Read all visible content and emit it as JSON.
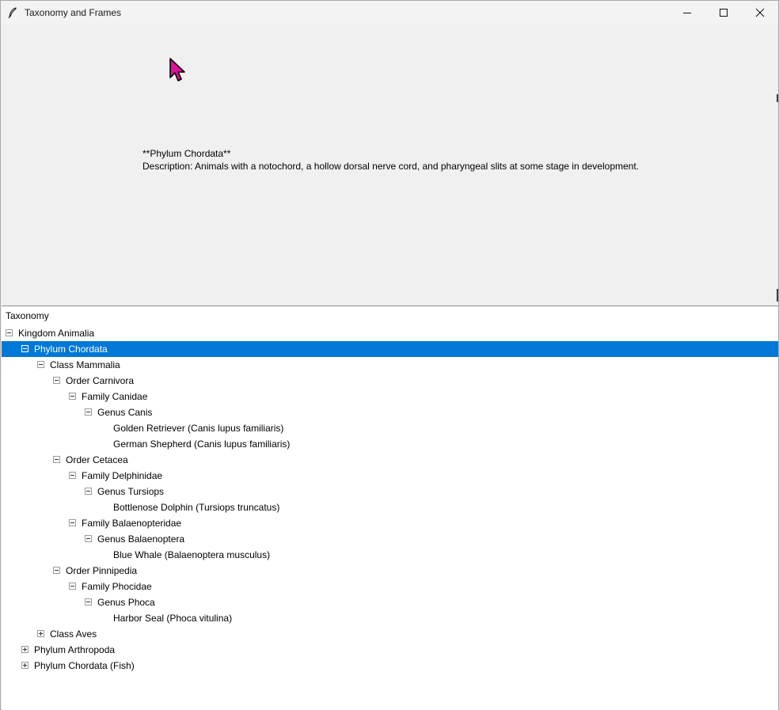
{
  "window": {
    "title": "Taxonomy and Frames",
    "app_icon": "feather-icon",
    "controls": [
      "minimize-icon",
      "maximize-icon",
      "close-icon"
    ]
  },
  "detail": {
    "heading": "**Phylum Chordata**",
    "description": "Description: Animals with a notochord, a hollow dorsal nerve cord, and pharyngeal slits at some stage in development."
  },
  "tree": {
    "heading": "Taxonomy",
    "selected_color": "#0078d7",
    "rows": [
      {
        "label": "Kingdom Animalia",
        "level": 0,
        "toggle": "minus",
        "selected": false
      },
      {
        "label": "Phylum Chordata",
        "level": 1,
        "toggle": "minus",
        "selected": true
      },
      {
        "label": "Class Mammalia",
        "level": 2,
        "toggle": "minus",
        "selected": false
      },
      {
        "label": "Order Carnivora",
        "level": 3,
        "toggle": "minus",
        "selected": false
      },
      {
        "label": "Family Canidae",
        "level": 4,
        "toggle": "minus",
        "selected": false
      },
      {
        "label": "Genus Canis",
        "level": 5,
        "toggle": "minus",
        "selected": false
      },
      {
        "label": "Golden Retriever (Canis lupus familiaris)",
        "level": 6,
        "toggle": "none",
        "selected": false
      },
      {
        "label": "German Shepherd (Canis lupus familiaris)",
        "level": 6,
        "toggle": "none",
        "selected": false
      },
      {
        "label": "Order Cetacea",
        "level": 3,
        "toggle": "minus",
        "selected": false
      },
      {
        "label": "Family Delphinidae",
        "level": 4,
        "toggle": "minus",
        "selected": false
      },
      {
        "label": "Genus Tursiops",
        "level": 5,
        "toggle": "minus",
        "selected": false
      },
      {
        "label": "Bottlenose Dolphin (Tursiops truncatus)",
        "level": 6,
        "toggle": "none",
        "selected": false
      },
      {
        "label": "Family Balaenopteridae",
        "level": 4,
        "toggle": "minus",
        "selected": false
      },
      {
        "label": "Genus Balaenoptera",
        "level": 5,
        "toggle": "minus",
        "selected": false
      },
      {
        "label": "Blue Whale (Balaenoptera musculus)",
        "level": 6,
        "toggle": "none",
        "selected": false
      },
      {
        "label": "Order Pinnipedia",
        "level": 3,
        "toggle": "minus",
        "selected": false
      },
      {
        "label": "Family Phocidae",
        "level": 4,
        "toggle": "minus",
        "selected": false
      },
      {
        "label": "Genus Phoca",
        "level": 5,
        "toggle": "minus",
        "selected": false
      },
      {
        "label": "Harbor Seal (Phoca vitulina)",
        "level": 6,
        "toggle": "none",
        "selected": false
      },
      {
        "label": "Class Aves",
        "level": 2,
        "toggle": "plus",
        "selected": false
      },
      {
        "label": "Phylum Arthropoda",
        "level": 1,
        "toggle": "plus",
        "selected": false
      },
      {
        "label": "Phylum Chordata (Fish)",
        "level": 1,
        "toggle": "plus",
        "selected": false
      }
    ]
  }
}
